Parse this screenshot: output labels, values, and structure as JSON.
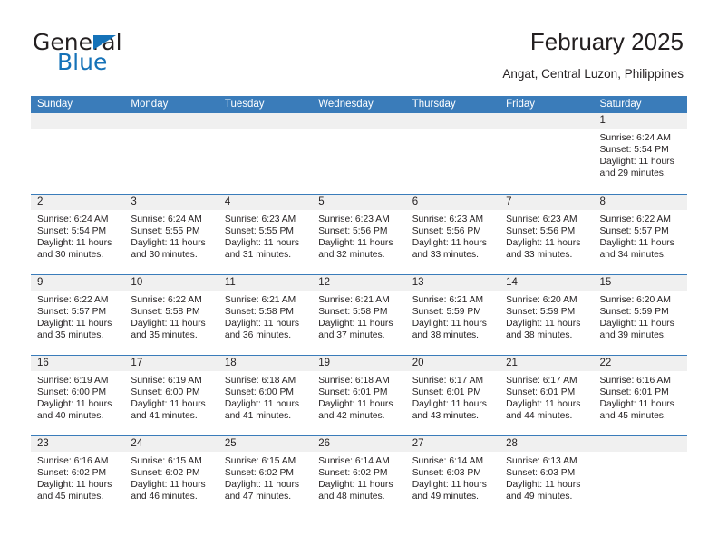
{
  "logo": {
    "word1": "General",
    "word2": "Blue",
    "triangle_color": "#1572b8"
  },
  "header": {
    "title": "February 2025",
    "subtitle": "Angat, Central Luzon, Philippines"
  },
  "theme": {
    "header_blue": "#3a7cba",
    "daynum_band": "#f0f0f0",
    "text": "#231f20"
  },
  "weekdays": [
    "Sunday",
    "Monday",
    "Tuesday",
    "Wednesday",
    "Thursday",
    "Friday",
    "Saturday"
  ],
  "weeks": [
    [
      {
        "day": "",
        "sunrise": "",
        "sunset": "",
        "daylight1": "",
        "daylight2": ""
      },
      {
        "day": "",
        "sunrise": "",
        "sunset": "",
        "daylight1": "",
        "daylight2": ""
      },
      {
        "day": "",
        "sunrise": "",
        "sunset": "",
        "daylight1": "",
        "daylight2": ""
      },
      {
        "day": "",
        "sunrise": "",
        "sunset": "",
        "daylight1": "",
        "daylight2": ""
      },
      {
        "day": "",
        "sunrise": "",
        "sunset": "",
        "daylight1": "",
        "daylight2": ""
      },
      {
        "day": "",
        "sunrise": "",
        "sunset": "",
        "daylight1": "",
        "daylight2": ""
      },
      {
        "day": "1",
        "sunrise": "Sunrise: 6:24 AM",
        "sunset": "Sunset: 5:54 PM",
        "daylight1": "Daylight: 11 hours",
        "daylight2": "and 29 minutes."
      }
    ],
    [
      {
        "day": "2",
        "sunrise": "Sunrise: 6:24 AM",
        "sunset": "Sunset: 5:54 PM",
        "daylight1": "Daylight: 11 hours",
        "daylight2": "and 30 minutes."
      },
      {
        "day": "3",
        "sunrise": "Sunrise: 6:24 AM",
        "sunset": "Sunset: 5:55 PM",
        "daylight1": "Daylight: 11 hours",
        "daylight2": "and 30 minutes."
      },
      {
        "day": "4",
        "sunrise": "Sunrise: 6:23 AM",
        "sunset": "Sunset: 5:55 PM",
        "daylight1": "Daylight: 11 hours",
        "daylight2": "and 31 minutes."
      },
      {
        "day": "5",
        "sunrise": "Sunrise: 6:23 AM",
        "sunset": "Sunset: 5:56 PM",
        "daylight1": "Daylight: 11 hours",
        "daylight2": "and 32 minutes."
      },
      {
        "day": "6",
        "sunrise": "Sunrise: 6:23 AM",
        "sunset": "Sunset: 5:56 PM",
        "daylight1": "Daylight: 11 hours",
        "daylight2": "and 33 minutes."
      },
      {
        "day": "7",
        "sunrise": "Sunrise: 6:23 AM",
        "sunset": "Sunset: 5:56 PM",
        "daylight1": "Daylight: 11 hours",
        "daylight2": "and 33 minutes."
      },
      {
        "day": "8",
        "sunrise": "Sunrise: 6:22 AM",
        "sunset": "Sunset: 5:57 PM",
        "daylight1": "Daylight: 11 hours",
        "daylight2": "and 34 minutes."
      }
    ],
    [
      {
        "day": "9",
        "sunrise": "Sunrise: 6:22 AM",
        "sunset": "Sunset: 5:57 PM",
        "daylight1": "Daylight: 11 hours",
        "daylight2": "and 35 minutes."
      },
      {
        "day": "10",
        "sunrise": "Sunrise: 6:22 AM",
        "sunset": "Sunset: 5:58 PM",
        "daylight1": "Daylight: 11 hours",
        "daylight2": "and 35 minutes."
      },
      {
        "day": "11",
        "sunrise": "Sunrise: 6:21 AM",
        "sunset": "Sunset: 5:58 PM",
        "daylight1": "Daylight: 11 hours",
        "daylight2": "and 36 minutes."
      },
      {
        "day": "12",
        "sunrise": "Sunrise: 6:21 AM",
        "sunset": "Sunset: 5:58 PM",
        "daylight1": "Daylight: 11 hours",
        "daylight2": "and 37 minutes."
      },
      {
        "day": "13",
        "sunrise": "Sunrise: 6:21 AM",
        "sunset": "Sunset: 5:59 PM",
        "daylight1": "Daylight: 11 hours",
        "daylight2": "and 38 minutes."
      },
      {
        "day": "14",
        "sunrise": "Sunrise: 6:20 AM",
        "sunset": "Sunset: 5:59 PM",
        "daylight1": "Daylight: 11 hours",
        "daylight2": "and 38 minutes."
      },
      {
        "day": "15",
        "sunrise": "Sunrise: 6:20 AM",
        "sunset": "Sunset: 5:59 PM",
        "daylight1": "Daylight: 11 hours",
        "daylight2": "and 39 minutes."
      }
    ],
    [
      {
        "day": "16",
        "sunrise": "Sunrise: 6:19 AM",
        "sunset": "Sunset: 6:00 PM",
        "daylight1": "Daylight: 11 hours",
        "daylight2": "and 40 minutes."
      },
      {
        "day": "17",
        "sunrise": "Sunrise: 6:19 AM",
        "sunset": "Sunset: 6:00 PM",
        "daylight1": "Daylight: 11 hours",
        "daylight2": "and 41 minutes."
      },
      {
        "day": "18",
        "sunrise": "Sunrise: 6:18 AM",
        "sunset": "Sunset: 6:00 PM",
        "daylight1": "Daylight: 11 hours",
        "daylight2": "and 41 minutes."
      },
      {
        "day": "19",
        "sunrise": "Sunrise: 6:18 AM",
        "sunset": "Sunset: 6:01 PM",
        "daylight1": "Daylight: 11 hours",
        "daylight2": "and 42 minutes."
      },
      {
        "day": "20",
        "sunrise": "Sunrise: 6:17 AM",
        "sunset": "Sunset: 6:01 PM",
        "daylight1": "Daylight: 11 hours",
        "daylight2": "and 43 minutes."
      },
      {
        "day": "21",
        "sunrise": "Sunrise: 6:17 AM",
        "sunset": "Sunset: 6:01 PM",
        "daylight1": "Daylight: 11 hours",
        "daylight2": "and 44 minutes."
      },
      {
        "day": "22",
        "sunrise": "Sunrise: 6:16 AM",
        "sunset": "Sunset: 6:01 PM",
        "daylight1": "Daylight: 11 hours",
        "daylight2": "and 45 minutes."
      }
    ],
    [
      {
        "day": "23",
        "sunrise": "Sunrise: 6:16 AM",
        "sunset": "Sunset: 6:02 PM",
        "daylight1": "Daylight: 11 hours",
        "daylight2": "and 45 minutes."
      },
      {
        "day": "24",
        "sunrise": "Sunrise: 6:15 AM",
        "sunset": "Sunset: 6:02 PM",
        "daylight1": "Daylight: 11 hours",
        "daylight2": "and 46 minutes."
      },
      {
        "day": "25",
        "sunrise": "Sunrise: 6:15 AM",
        "sunset": "Sunset: 6:02 PM",
        "daylight1": "Daylight: 11 hours",
        "daylight2": "and 47 minutes."
      },
      {
        "day": "26",
        "sunrise": "Sunrise: 6:14 AM",
        "sunset": "Sunset: 6:02 PM",
        "daylight1": "Daylight: 11 hours",
        "daylight2": "and 48 minutes."
      },
      {
        "day": "27",
        "sunrise": "Sunrise: 6:14 AM",
        "sunset": "Sunset: 6:03 PM",
        "daylight1": "Daylight: 11 hours",
        "daylight2": "and 49 minutes."
      },
      {
        "day": "28",
        "sunrise": "Sunrise: 6:13 AM",
        "sunset": "Sunset: 6:03 PM",
        "daylight1": "Daylight: 11 hours",
        "daylight2": "and 49 minutes."
      },
      {
        "day": "",
        "sunrise": "",
        "sunset": "",
        "daylight1": "",
        "daylight2": ""
      }
    ]
  ]
}
